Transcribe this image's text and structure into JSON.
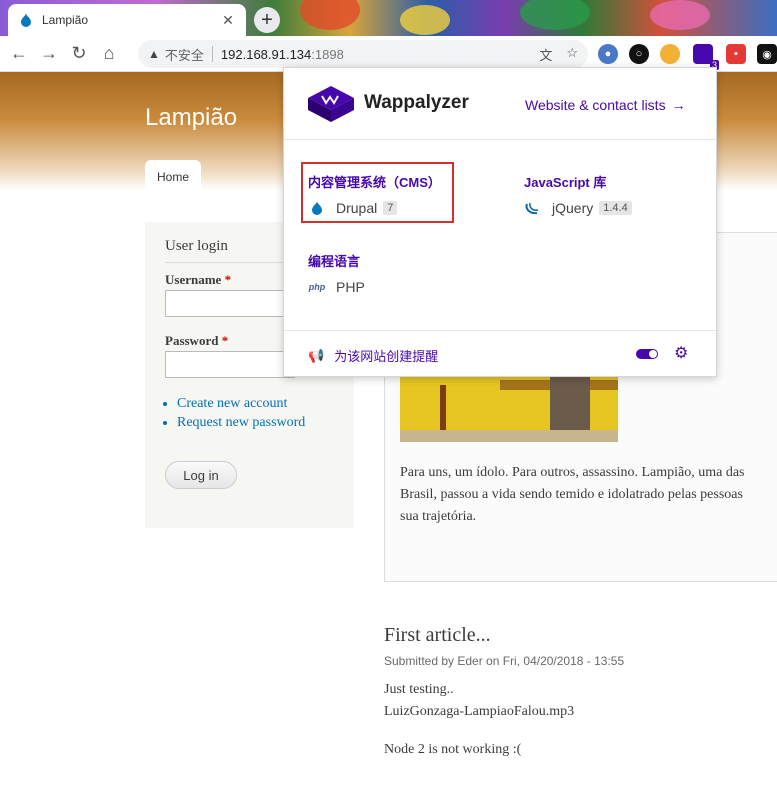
{
  "browser": {
    "tab_title": "Lampião",
    "new_tab_symbol": "+",
    "close_symbol": "✕",
    "omnibox": {
      "security_label": "不安全",
      "host": "192.168.91.134",
      "port": ":1898"
    },
    "extension_badge": "3"
  },
  "page": {
    "site_name": "Lampião",
    "nav_home": "Home",
    "login_block": {
      "title": "User login",
      "username_label": "Username",
      "password_label": "Password",
      "required_mark": "*",
      "links": [
        "Create new account",
        "Request new password"
      ],
      "login_button": "Log in"
    },
    "node_body": [
      "Para uns, um ídolo. Para outros, assassino. Lampião, uma das",
      "Brasil, passou a vida sendo temido e idolatrado pelas pessoas",
      "sua trajetória."
    ],
    "article": {
      "title": "First article...",
      "submitted": "Submitted by Eder on Fri, 04/20/2018 - 13:55",
      "lines": [
        "Just testing..",
        "LuizGonzaga-LampiaoFalou.mp3",
        "",
        "Node 2 is not working :("
      ]
    }
  },
  "wappalyzer": {
    "brand": "Wappalyzer",
    "header_link": "Website & contact lists",
    "categories": [
      {
        "name": "内容管理系统（CMS）",
        "tech": "Drupal",
        "version": "7",
        "icon": "drupal-drop-icon"
      },
      {
        "name": "JavaScript 库",
        "tech": "jQuery",
        "version": "1.4.4",
        "icon": "jquery-icon"
      },
      {
        "name": "编程语言",
        "tech": "PHP",
        "version": "",
        "icon": "php-icon"
      }
    ],
    "footer_alert": "为该网站创建提醒",
    "colors": {
      "accent": "#4608ad",
      "highlight": "#d32f2f"
    }
  }
}
